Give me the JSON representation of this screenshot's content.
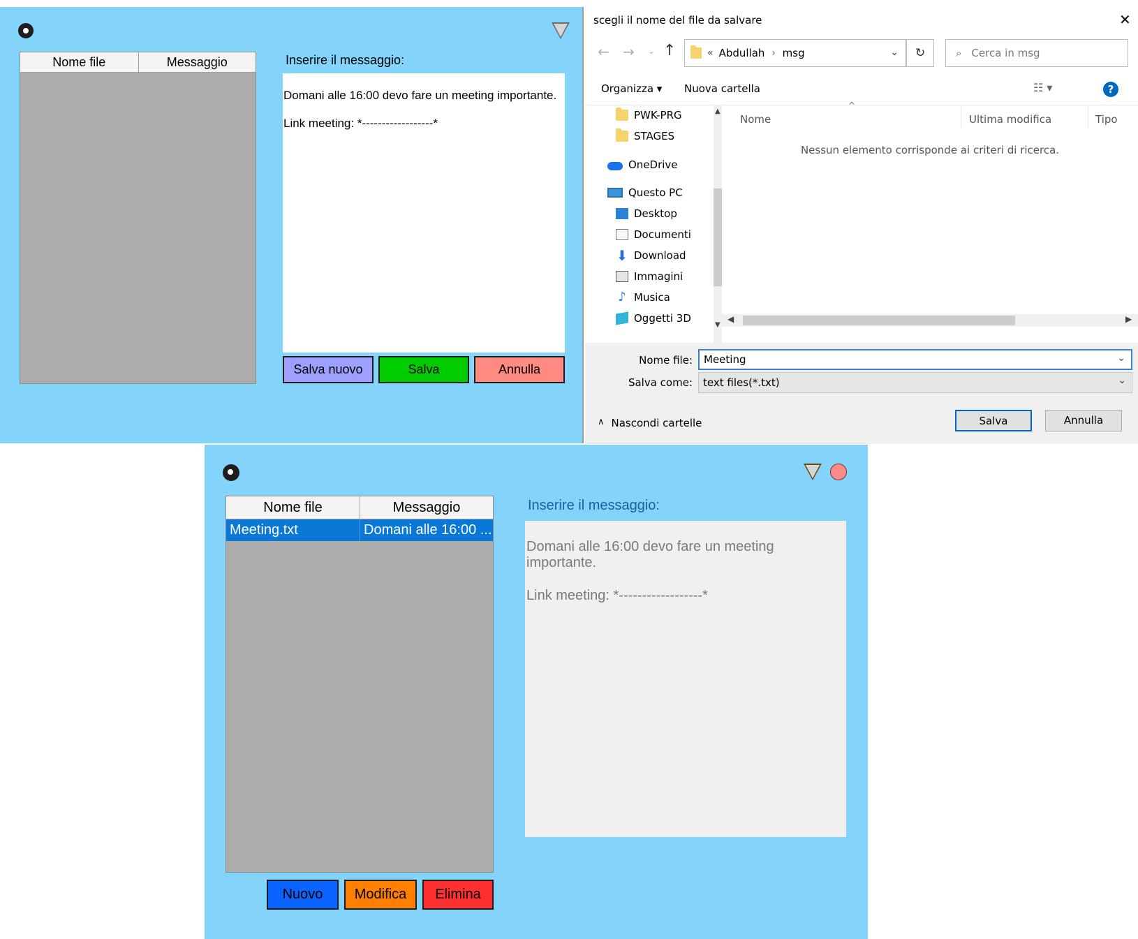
{
  "app1": {
    "list": {
      "col_file": "Nome file",
      "col_msg": "Messaggio"
    },
    "message_label": "Inserire il messaggio:",
    "message_line1": "Domani alle 16:00 devo fare un meeting importante.",
    "message_line2": "Link meeting: *------------------*",
    "btn_save_new": "Salva nuovo",
    "btn_save": "Salva",
    "btn_cancel": "Annulla",
    "colors": {
      "bg": "#83d3fb",
      "save_new": "#9da0ff",
      "save": "#00cc00",
      "cancel": "#ff8a82"
    }
  },
  "dialog": {
    "title": "scegli il nome del file da salvare",
    "close_glyph": "✕",
    "breadcrumb_prefix": "«",
    "breadcrumb": [
      "Abdullah",
      "msg"
    ],
    "search_placeholder": "Cerca in msg",
    "toolbar": {
      "organize": "Organizza ▾",
      "new_folder": "Nuova cartella"
    },
    "nav_items": [
      {
        "label": "PWK-PRG",
        "icon": "folder-icon"
      },
      {
        "label": "STAGES",
        "icon": "folder-icon"
      },
      {
        "label": "OneDrive",
        "icon": "onedrive-icon"
      },
      {
        "label": "Questo PC",
        "icon": "computer-icon"
      },
      {
        "label": "Desktop",
        "icon": "desktop-icon"
      },
      {
        "label": "Documenti",
        "icon": "documents-icon"
      },
      {
        "label": "Download",
        "icon": "download-icon"
      },
      {
        "label": "Immagini",
        "icon": "pictures-icon"
      },
      {
        "label": "Musica",
        "icon": "music-icon"
      },
      {
        "label": "Oggetti 3D",
        "icon": "objects3d-icon"
      }
    ],
    "columns": {
      "name": "Nome",
      "modified": "Ultima modifica",
      "type": "Tipo"
    },
    "empty_message": "Nessun elemento corrisponde ai criteri di ricerca.",
    "filename_label": "Nome file:",
    "filename_value": "Meeting",
    "savetype_label": "Salva come:",
    "savetype_value": "text files(*.txt)",
    "hide_folders": "Nascondi cartelle",
    "save_button": "Salva",
    "cancel_button": "Annulla"
  },
  "app2": {
    "list": {
      "col_file": "Nome file",
      "col_msg": "Messaggio",
      "rows": [
        {
          "file": "Meeting.txt",
          "msg": "Domani alle 16:00 ..."
        }
      ]
    },
    "message_label": "Inserire il messaggio:",
    "message_line1": "Domani alle 16:00 devo fare un meeting importante.",
    "message_line2": "Link meeting: *------------------*",
    "btn_new": "Nuovo",
    "btn_edit": "Modifica",
    "btn_delete": "Elimina",
    "colors": {
      "new": "#0a64ff",
      "edit": "#ff7f00",
      "delete": "#ff3030",
      "minimize": "#ffc56a",
      "close": "#ff8a8a"
    }
  }
}
